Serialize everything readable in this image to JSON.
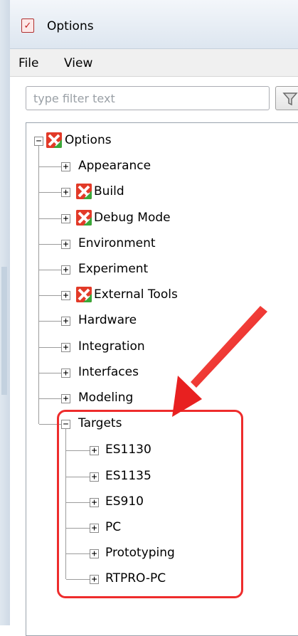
{
  "window": {
    "title": "Options",
    "title_icon": "checklist-app-icon"
  },
  "menu": {
    "items": [
      "File",
      "View"
    ]
  },
  "filter": {
    "placeholder": "type filter text",
    "value": "",
    "button_icon": "filter-funnel-icon"
  },
  "tree": {
    "root": {
      "label": "Options",
      "expanded": true,
      "icon": "options-cross-icon"
    },
    "items": [
      {
        "label": "Appearance",
        "icon": null
      },
      {
        "label": "Build",
        "icon": "options-cross-icon"
      },
      {
        "label": "Debug Mode",
        "icon": "options-cross-icon"
      },
      {
        "label": "Environment",
        "icon": null
      },
      {
        "label": "Experiment",
        "icon": null
      },
      {
        "label": "External Tools",
        "icon": "options-cross-icon"
      },
      {
        "label": "Hardware",
        "icon": null
      },
      {
        "label": "Integration",
        "icon": null
      },
      {
        "label": "Interfaces",
        "icon": null
      },
      {
        "label": "Modeling",
        "icon": null
      },
      {
        "label": "Targets",
        "icon": null,
        "expanded": true
      }
    ],
    "targets": [
      {
        "label": "ES1130"
      },
      {
        "label": "ES1135"
      },
      {
        "label": "ES910"
      },
      {
        "label": "PC"
      },
      {
        "label": "Prototyping"
      },
      {
        "label": "RTPRO-PC"
      }
    ]
  },
  "annotation": {
    "color": "#ee2c2c"
  },
  "colors": {
    "icon_red": "#e23a28",
    "icon_green": "#3aa83a",
    "tree_line": "#9c9c9c"
  }
}
